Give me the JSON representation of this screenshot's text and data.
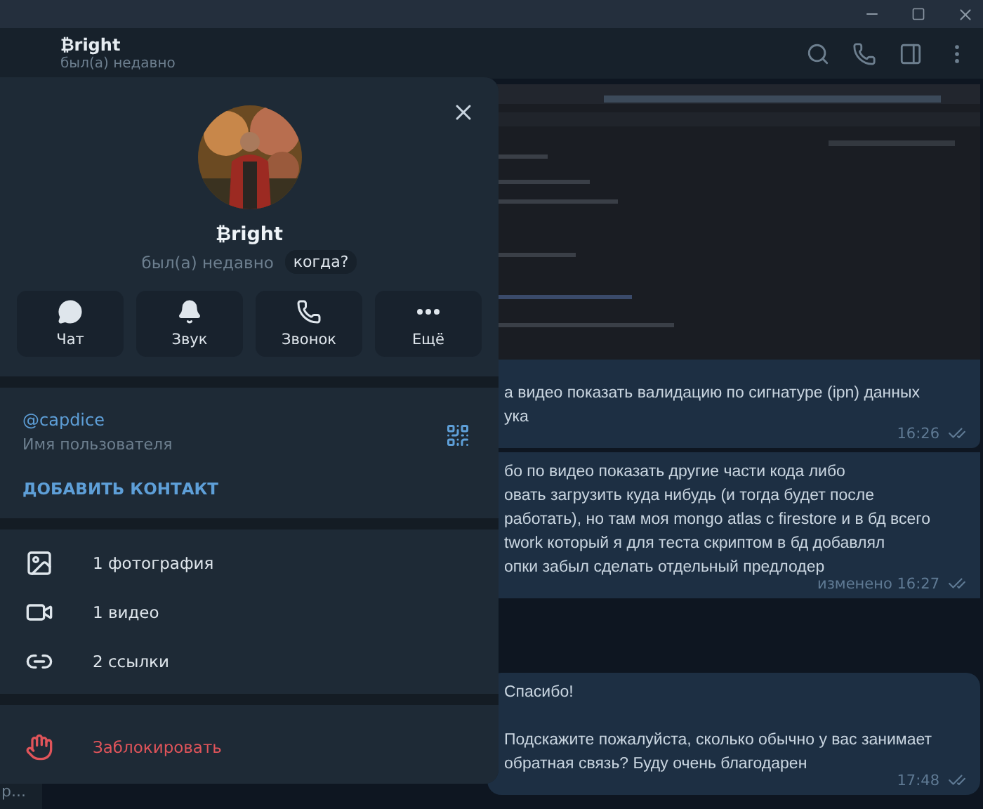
{
  "chat_header": {
    "name": "₿right",
    "status": "был(а) недавно"
  },
  "chat_list_preview": "р...",
  "messages": [
    {
      "kind": "picture"
    },
    {
      "kind": "text",
      "paragraphs": [
        [
          "а видео показать валидацию по сигнатуре (ipn) данных",
          "ука"
        ]
      ],
      "time": "16:26",
      "read": true
    },
    {
      "kind": "text",
      "paragraphs": [
        [
          "бо по видео показать другие части кода либо",
          "овать загрузить куда нибудь (и тогда будет после",
          "работать), но там моя mongo atlas c firestore и в бд всего",
          "twork который я для теста скриптом в бд добавлял",
          "опки забыл сделать отдельный предлодер"
        ]
      ],
      "time": "изменено 16:27",
      "read": true
    },
    {
      "kind": "text",
      "paragraphs": [
        [
          "Спасибо!"
        ],
        [
          "Подскажите пожалуйста, сколько обычно у вас занимает",
          "обратная связь? Буду очень благодарен"
        ]
      ],
      "time": "17:48",
      "read": true
    }
  ],
  "profile": {
    "name": "₿right",
    "status": "был(а) недавно",
    "when_label": "когда?",
    "actions": [
      {
        "kind": "chat",
        "label": "Чат"
      },
      {
        "kind": "sound",
        "label": "Звук"
      },
      {
        "kind": "call",
        "label": "Звонок"
      },
      {
        "kind": "more",
        "label": "Ещё"
      }
    ],
    "username": "@capdice",
    "username_caption": "Имя пользователя",
    "add_contact": "ДОБАВИТЬ КОНТАКТ",
    "media": [
      {
        "label": "1 фотография"
      },
      {
        "kind": "video",
        "label": "1 видео"
      },
      {
        "kind": "link",
        "label": "2 ссылки"
      }
    ],
    "block": "Заблокировать"
  }
}
